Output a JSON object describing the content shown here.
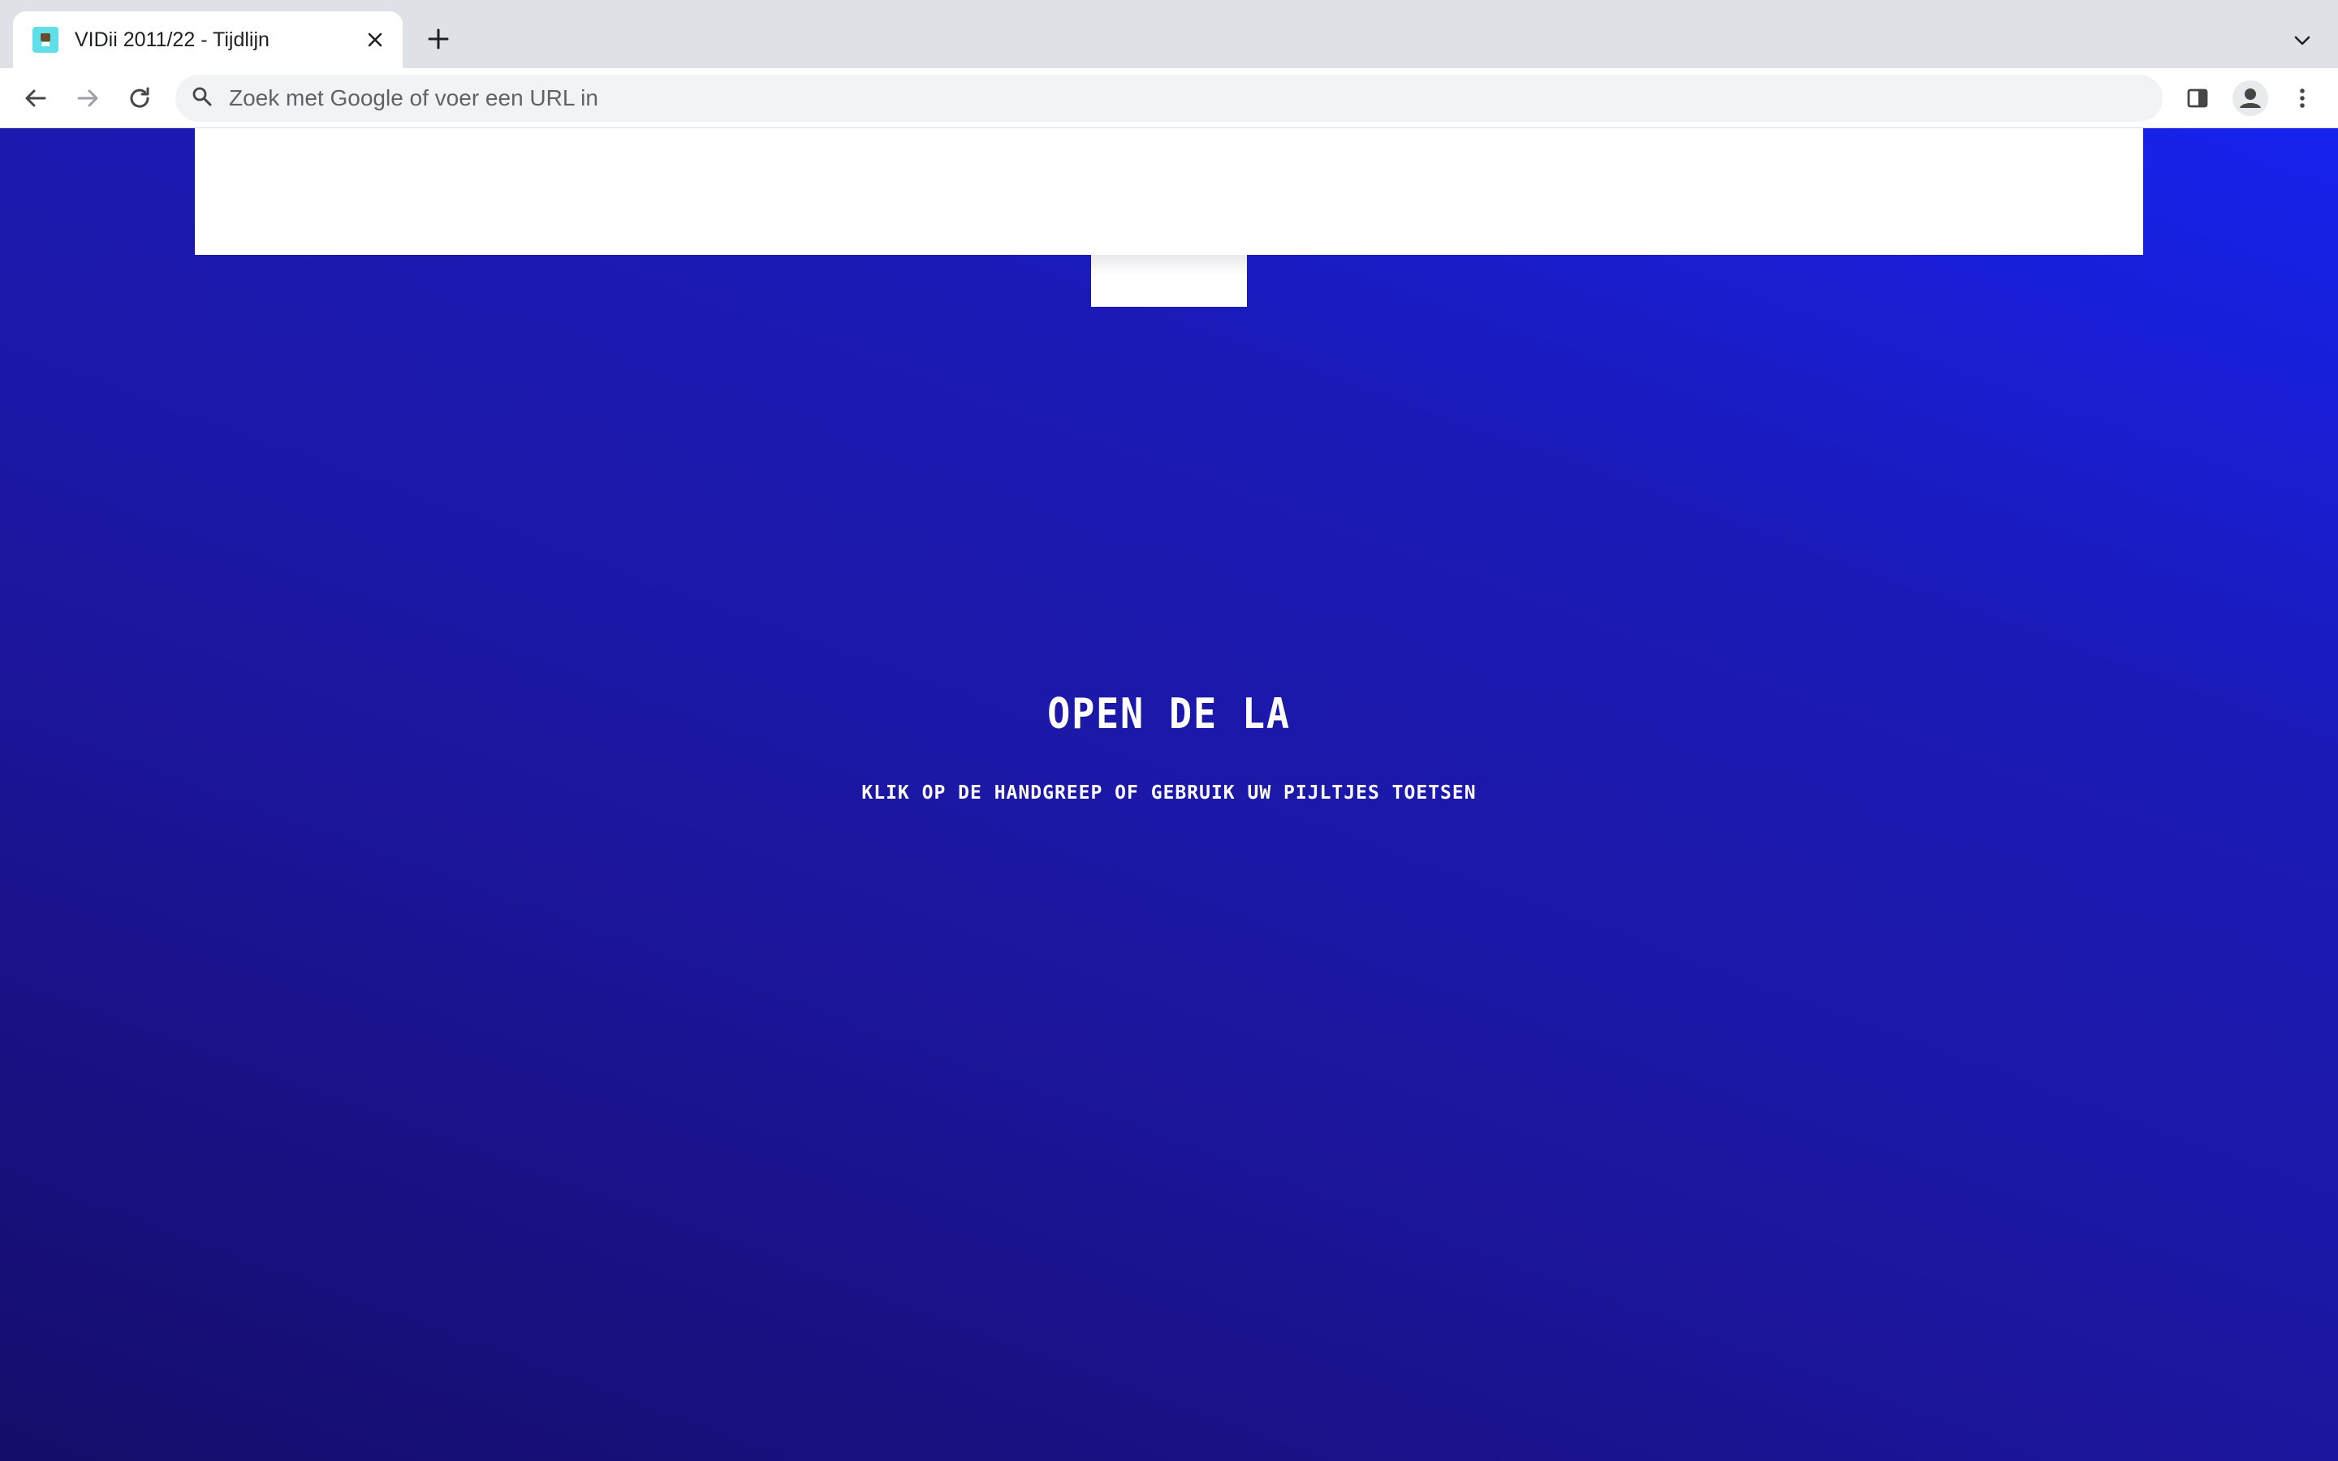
{
  "browser": {
    "tab": {
      "title": "VIDii 2011/22 - Tijdlijn",
      "favicon": "vidii-favicon",
      "close_icon": "close-icon"
    },
    "new_tab_icon": "plus-icon",
    "tab_search_icon": "chevron-down-icon",
    "toolbar": {
      "back_icon": "arrow-left-icon",
      "forward_icon": "arrow-right-icon",
      "reload_icon": "reload-icon",
      "omnibox_placeholder": "Zoek met Google of voer een URL in",
      "omnibox_value": "",
      "side_panel_icon": "side-panel-icon",
      "profile_icon": "profile-avatar-icon",
      "menu_icon": "kebab-menu-icon"
    }
  },
  "page": {
    "headline": "OPEN DE LA",
    "instruction": "KLIK OP DE HANDGREEP OF GEBRUIK UW PIJLTJES TOETSEN",
    "colors": {
      "background_dark": "#150d6a",
      "background_mid": "#1c169f",
      "background_bright": "#1722ee",
      "drawer": "#ffffff",
      "text": "#ffffff"
    }
  }
}
